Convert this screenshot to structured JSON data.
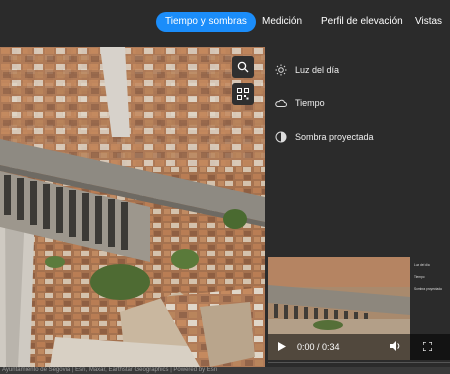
{
  "nav": {
    "tabs": [
      {
        "label": "Tiempo y sombras",
        "active": true
      },
      {
        "label": "Medición",
        "active": false
      },
      {
        "label": "Perfil de elevación",
        "active": false
      },
      {
        "label": "Vistas",
        "active": false
      }
    ]
  },
  "scene_tools": {
    "search_icon": "search-icon",
    "qr_icon": "qr-code-icon"
  },
  "panel": {
    "items": [
      {
        "label": "Luz del día",
        "icon": "sun-icon"
      },
      {
        "label": "Tiempo",
        "icon": "cloud-icon"
      },
      {
        "label": "Sombra proyectada",
        "icon": "shadow-icon"
      }
    ]
  },
  "video": {
    "time": "0:00 / 0:34",
    "mini_panel_items": [
      "Luz del día",
      "Tiempo",
      "Sombra proyectada"
    ]
  },
  "footer": {
    "text": "Ayuntamiento de Segovia | Esri, Maxar, Earthstar Geographics | Powered by Esri"
  },
  "colors": {
    "accent": "#1b8dfa",
    "panel_bg": "#2b2b2b"
  }
}
